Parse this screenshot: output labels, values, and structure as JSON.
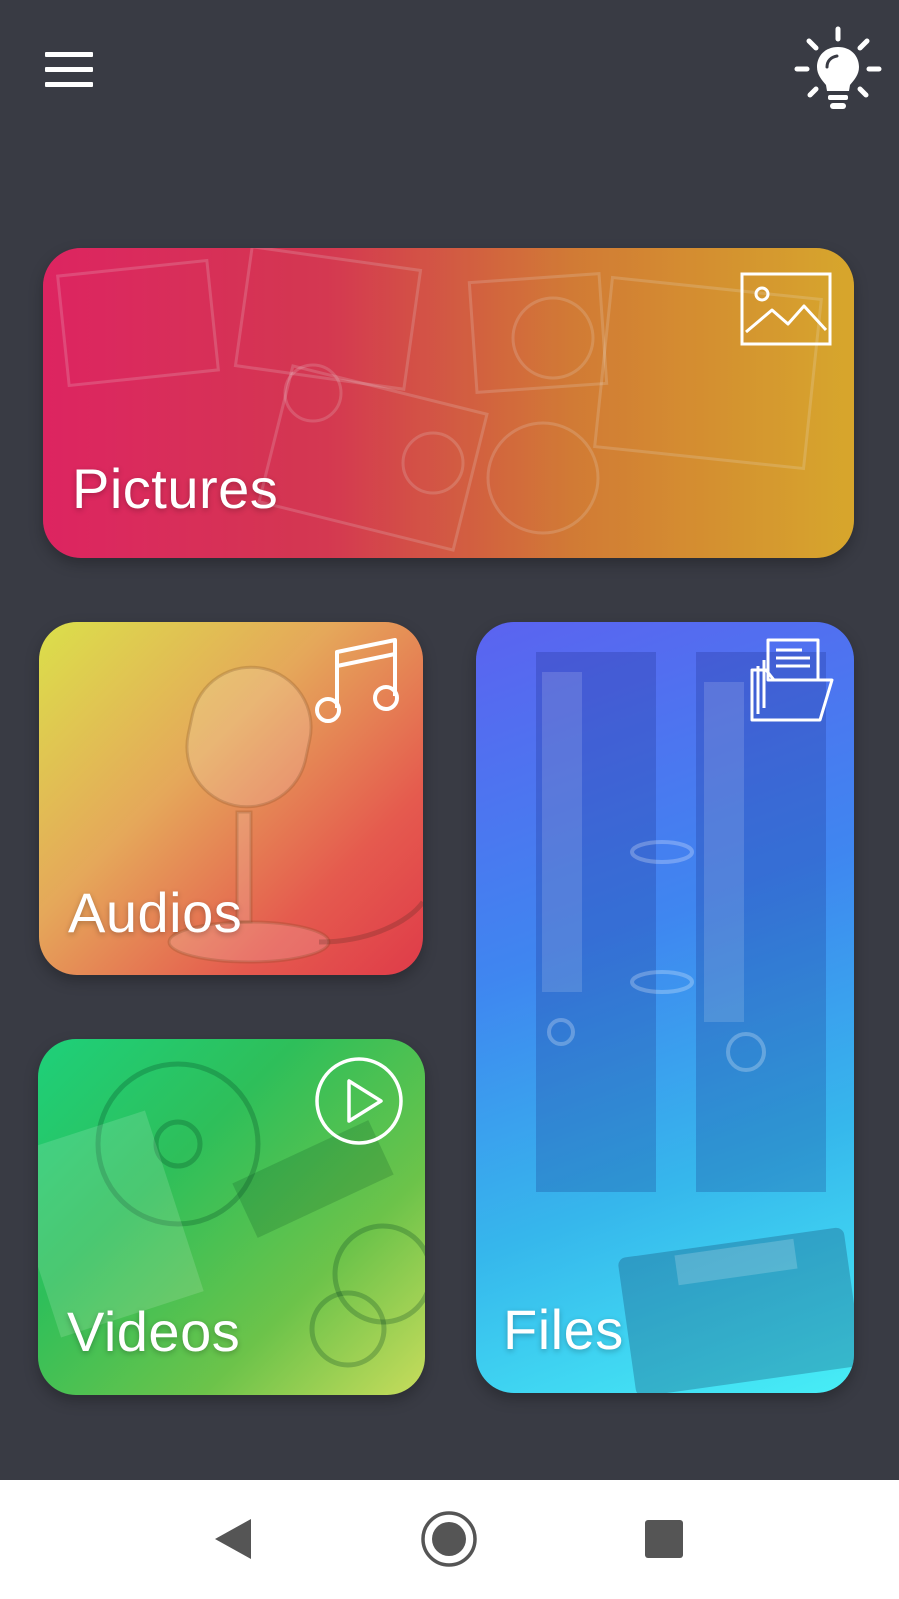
{
  "header": {
    "menu_icon": "hamburger-menu-icon",
    "theme_icon": "lightbulb-icon"
  },
  "tiles": {
    "pictures": {
      "label": "Pictures",
      "icon": "image-icon",
      "colors": [
        "#f0286a",
        "#eab530"
      ]
    },
    "audios": {
      "label": "Audios",
      "icon": "music-note-icon",
      "colors": [
        "#dbe04a",
        "#df3b49"
      ]
    },
    "videos": {
      "label": "Videos",
      "icon": "play-circle-icon",
      "colors": [
        "#1ed07a",
        "#c8dc5c"
      ]
    },
    "files": {
      "label": "Files",
      "icon": "folder-documents-icon",
      "colors": [
        "#5b63f0",
        "#47eef6"
      ]
    }
  },
  "navbar": {
    "back_icon": "back-triangle-icon",
    "home_icon": "home-circle-icon",
    "recents_icon": "recents-square-icon"
  },
  "theme": {
    "background": "#393b44",
    "navbar_background": "#ffffff"
  }
}
